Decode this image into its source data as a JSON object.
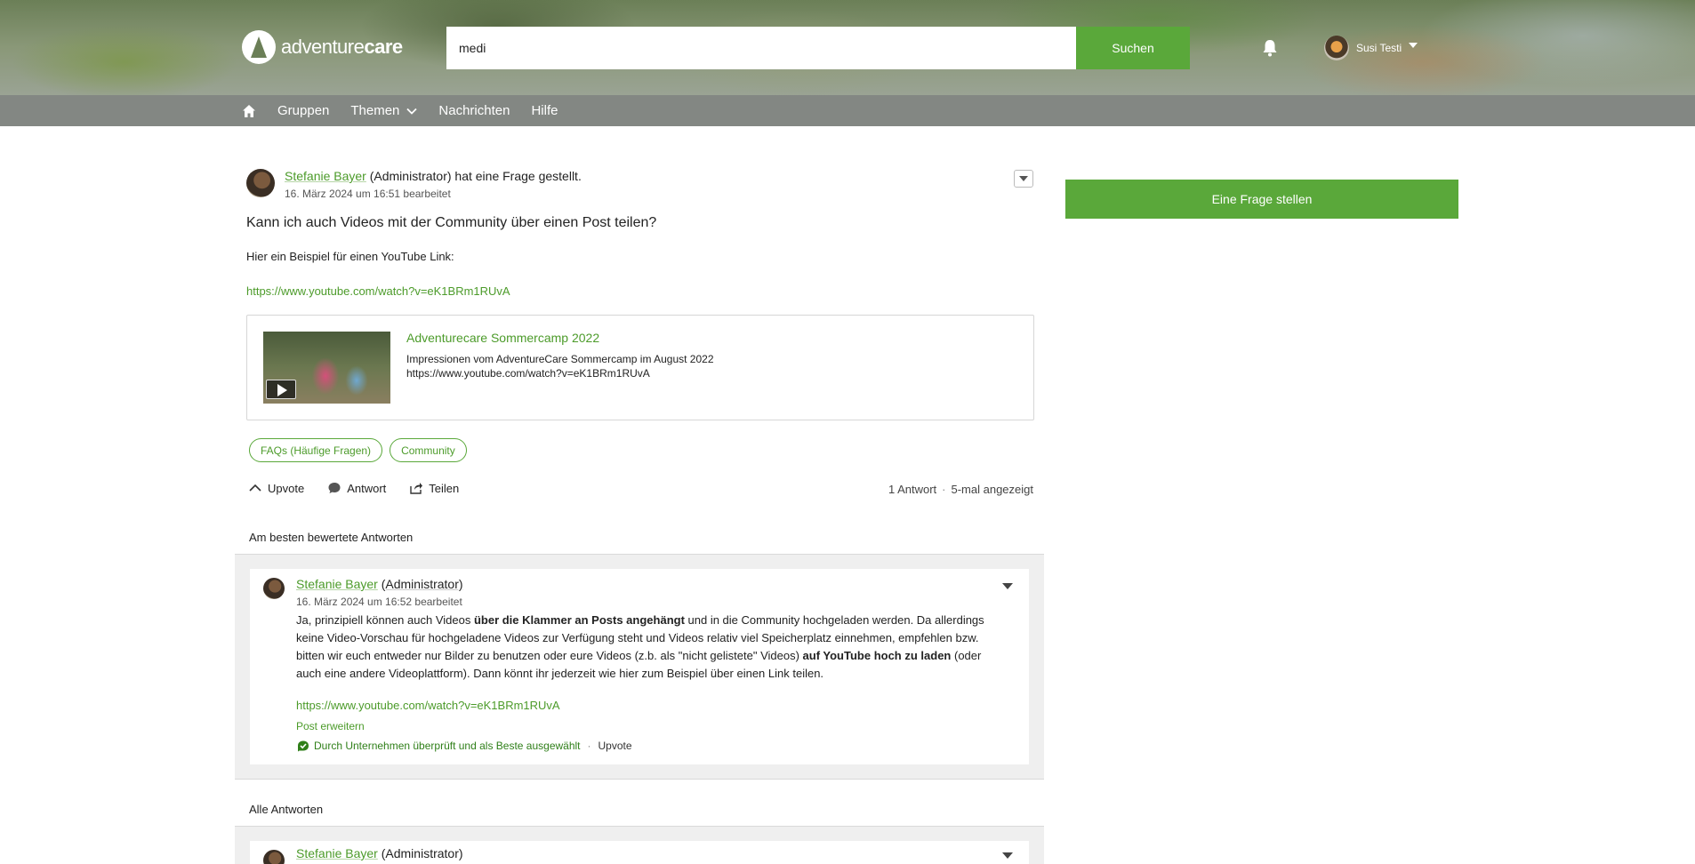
{
  "header": {
    "logo_text_light": "adventure",
    "logo_text_bold": "care",
    "search_value": "medi",
    "search_placeholder": "",
    "search_button": "Suchen",
    "user_name": "Susi Testi"
  },
  "nav": {
    "items": [
      "Gruppen",
      "Themen",
      "Nachrichten",
      "Hilfe"
    ]
  },
  "post": {
    "author": "Stefanie Bayer",
    "role_action": "(Administrator) hat eine Frage gestellt.",
    "date": "16. März 2024 um 16:51 bearbeitet",
    "title": "Kann ich auch Videos mit der Community über einen Post teilen?",
    "body": "Hier ein Beispiel für einen YouTube Link:",
    "link": "https://www.youtube.com/watch?v=eK1BRm1RUvA",
    "video": {
      "title": "Adventurecare Sommercamp 2022",
      "description": "Impressionen vom AdventureCare Sommercamp im August 2022",
      "url": "https://www.youtube.com/watch?v=eK1BRm1RUvA"
    },
    "tags": [
      "FAQs (Häufige Fragen)",
      "Community"
    ],
    "actions": {
      "upvote": "Upvote",
      "answer": "Antwort",
      "share": "Teilen"
    },
    "stats": {
      "answers": "1 Antwort",
      "views": "5-mal angezeigt"
    }
  },
  "sections": {
    "best": "Am besten bewertete Antworten",
    "all": "Alle Antworten"
  },
  "answer": {
    "author": "Stefanie Bayer",
    "role": "(Administrator)",
    "date": "16. März 2024 um 16:52 bearbeitet",
    "text_1": "Ja, prinzipiell können auch Videos ",
    "text_bold_1": "über die Klammer an Posts angehängt",
    "text_2": " und in die Community hochgeladen werden. Da allerdings keine Video-Vorschau für hochgeladene Videos zur Verfügung steht und Videos relativ viel Speicherplatz einnehmen, empfehlen bzw. bitten wir euch entweder nur Bilder zu benutzen oder eure Videos (z.b. als \"nicht gelistete\" Videos) ",
    "text_bold_2": "auf YouTube hoch zu laden",
    "text_3": " (oder auch eine andere Videoplattform). Dann könnt ihr jederzeit wie hier zum Beispiel über einen Link teilen.",
    "link": "https://www.youtube.com/watch?v=eK1BRm1RUvA",
    "expand": "Post erweitern",
    "verified": "Durch Unternehmen überprüft und als Beste ausgewählt",
    "separator": "·",
    "upvote": "Upvote"
  },
  "answer2": {
    "author": "Stefanie Bayer",
    "role": "(Administrator)"
  },
  "sidebar": {
    "ask_button": "Eine Frage stellen"
  },
  "colors": {
    "accent": "#5aa83a",
    "link": "#4c9b2a"
  }
}
